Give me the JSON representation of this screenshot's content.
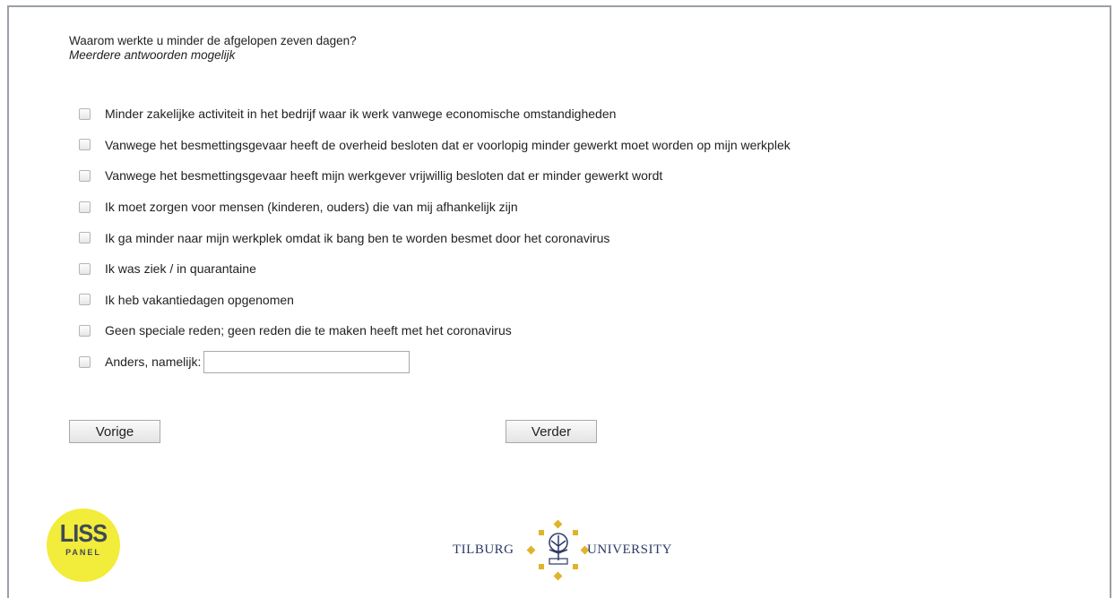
{
  "question": {
    "title": "Waarom werkte u minder de afgelopen zeven dagen?",
    "subtitle": "Meerdere antwoorden mogelijk"
  },
  "options": [
    "Minder zakelijke activiteit in het bedrijf waar ik werk vanwege economische omstandigheden",
    "Vanwege het besmettingsgevaar heeft de overheid besloten dat er voorlopig minder gewerkt moet worden op mijn werkplek",
    "Vanwege het besmettingsgevaar heeft mijn werkgever vrijwillig besloten dat er minder gewerkt wordt",
    "Ik moet zorgen voor mensen (kinderen, ouders) die van mij afhankelijk zijn",
    "Ik ga minder naar mijn werkplek omdat ik bang ben te worden besmet door het coronavirus",
    "Ik was ziek / in quarantaine",
    "Ik heb vakantiedagen opgenomen",
    "Geen speciale reden; geen reden die te maken heeft met het coronavirus"
  ],
  "other": {
    "label": "Anders, namelijk:",
    "value": ""
  },
  "buttons": {
    "prev": "Vorige",
    "next": "Verder"
  },
  "logos": {
    "liss_big": "LISS",
    "liss_small": "PANEL",
    "tilburg_left": "TILBURG",
    "tilburg_right": "UNIVERSITY",
    "liss_color": "#f2ec3a",
    "tilburg_gold": "#e0b32a",
    "tilburg_navy": "#2b3a67"
  }
}
